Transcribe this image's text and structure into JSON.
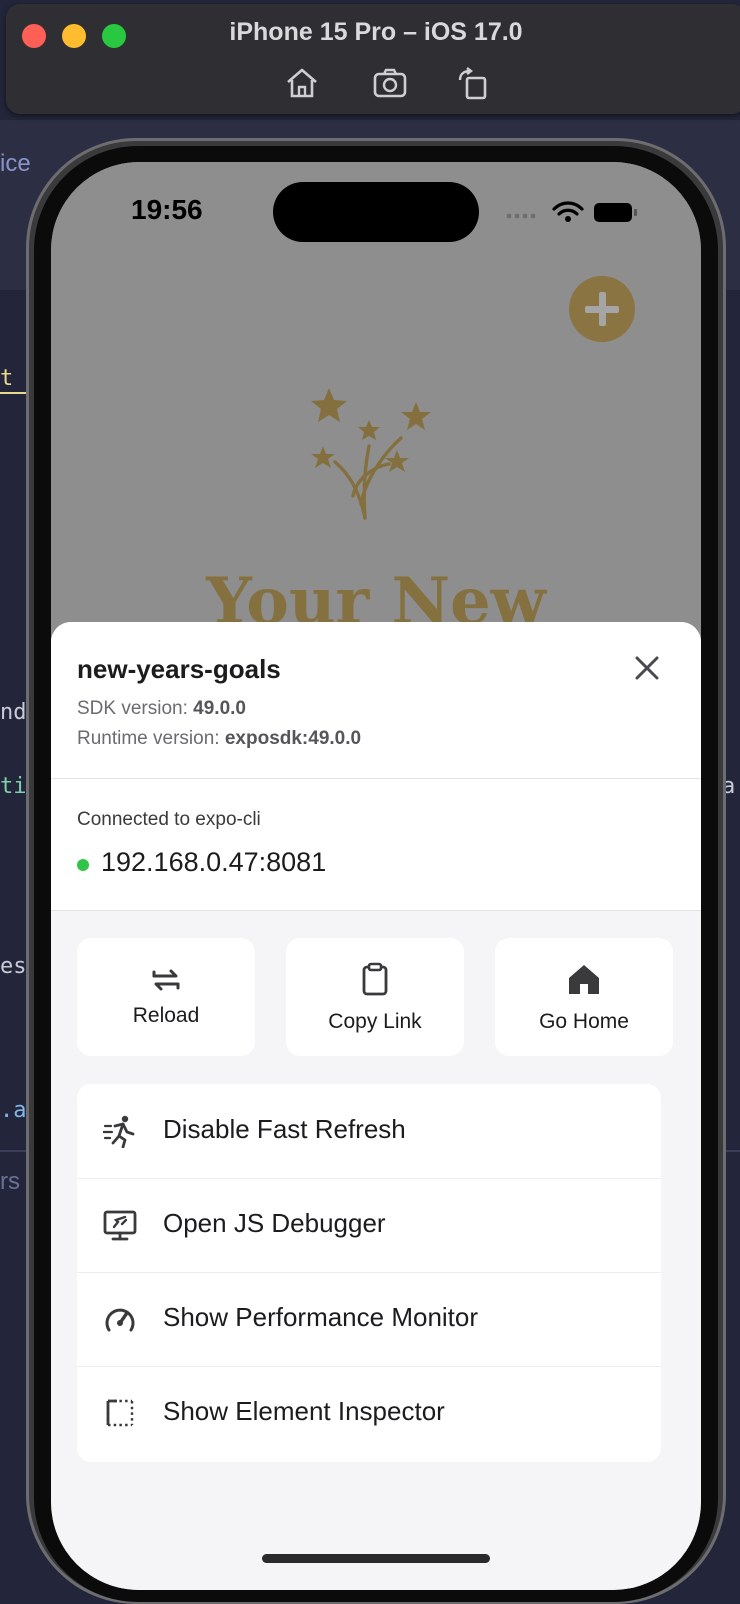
{
  "window": {
    "title": "iPhone 15 Pro – iOS 17.0",
    "toolbar": [
      "home-icon",
      "camera-icon",
      "rotate-icon"
    ],
    "colors": {
      "close": "#fe5f57",
      "minimize": "#febc2e",
      "zoom": "#28c840"
    }
  },
  "status_bar": {
    "time": "19:56"
  },
  "app": {
    "hero_title": "Your New"
  },
  "dev_menu": {
    "app_name": "new-years-goals",
    "sdk_label": "SDK version: ",
    "sdk_value": "49.0.0",
    "runtime_label": "Runtime version: ",
    "runtime_value": "exposdk:49.0.0",
    "connection_label": "Connected to expo-cli",
    "connection_host": "192.168.0.47:8081",
    "quick_actions": [
      {
        "label": "Reload",
        "icon": "reload-icon"
      },
      {
        "label": "Copy Link",
        "icon": "clipboard-icon"
      },
      {
        "label": "Go Home",
        "icon": "home-icon"
      }
    ],
    "items": [
      {
        "label": "Disable Fast Refresh",
        "icon": "running-figure-icon"
      },
      {
        "label": "Open JS Debugger",
        "icon": "debugger-monitor-icon"
      },
      {
        "label": "Show Performance Monitor",
        "icon": "speedometer-icon"
      },
      {
        "label": "Show Element Inspector",
        "icon": "inspector-selection-icon"
      }
    ]
  },
  "background_editor": {
    "fragments": [
      "ice",
      "t",
      "nd",
      "ti",
      "ess",
      ".a",
      "rs",
      "a"
    ]
  }
}
